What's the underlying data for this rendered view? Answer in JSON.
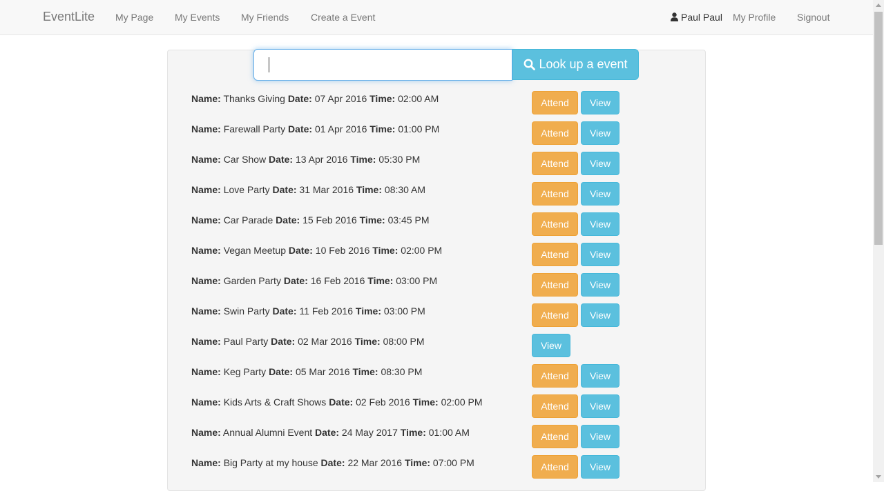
{
  "navbar": {
    "brand": "EventLite",
    "links": [
      "My Page",
      "My Events",
      "My Friends",
      "Create a Event"
    ],
    "user": "Paul Paul",
    "profile": "My Profile",
    "signout": "Signout"
  },
  "search": {
    "value": "",
    "button_label": "Look up a event",
    "button_icon": "search-icon"
  },
  "labels": {
    "name": "Name:",
    "date": "Date:",
    "time": "Time:"
  },
  "buttons": {
    "attend": "Attend",
    "view": "View"
  },
  "events": [
    {
      "name": "Thanks Giving",
      "date": "07 Apr 2016",
      "time": "02:00 AM",
      "attend": true
    },
    {
      "name": "Farewall Party",
      "date": "01 Apr 2016",
      "time": "01:00 PM",
      "attend": true
    },
    {
      "name": "Car Show",
      "date": "13 Apr 2016",
      "time": "05:30 PM",
      "attend": true
    },
    {
      "name": "Love Party",
      "date": "31 Mar 2016",
      "time": "08:30 AM",
      "attend": true
    },
    {
      "name": "Car Parade",
      "date": "15 Feb 2016",
      "time": "03:45 PM",
      "attend": true
    },
    {
      "name": "Vegan Meetup",
      "date": "10 Feb 2016",
      "time": "02:00 PM",
      "attend": true
    },
    {
      "name": "Garden Party",
      "date": "16 Feb 2016",
      "time": "03:00 PM",
      "attend": true
    },
    {
      "name": "Swin Party",
      "date": "11 Feb 2016",
      "time": "03:00 PM",
      "attend": true
    },
    {
      "name": "Paul Party",
      "date": "02 Mar 2016",
      "time": "08:00 PM",
      "attend": false
    },
    {
      "name": "Keg Party",
      "date": "05 Mar 2016",
      "time": "08:30 PM",
      "attend": true
    },
    {
      "name": "Kids Arts & Craft Shows",
      "date": "02 Feb 2016",
      "time": "02:00 PM",
      "attend": true
    },
    {
      "name": "Annual Alumni Event",
      "date": "24 May 2017",
      "time": "01:00 AM",
      "attend": true
    },
    {
      "name": "Big Party at my house",
      "date": "22 Mar 2016",
      "time": "07:00 PM",
      "attend": true
    }
  ],
  "colors": {
    "attend": "#f0ad4e",
    "view": "#5bc0de",
    "navbar_bg": "#f8f8f8"
  }
}
